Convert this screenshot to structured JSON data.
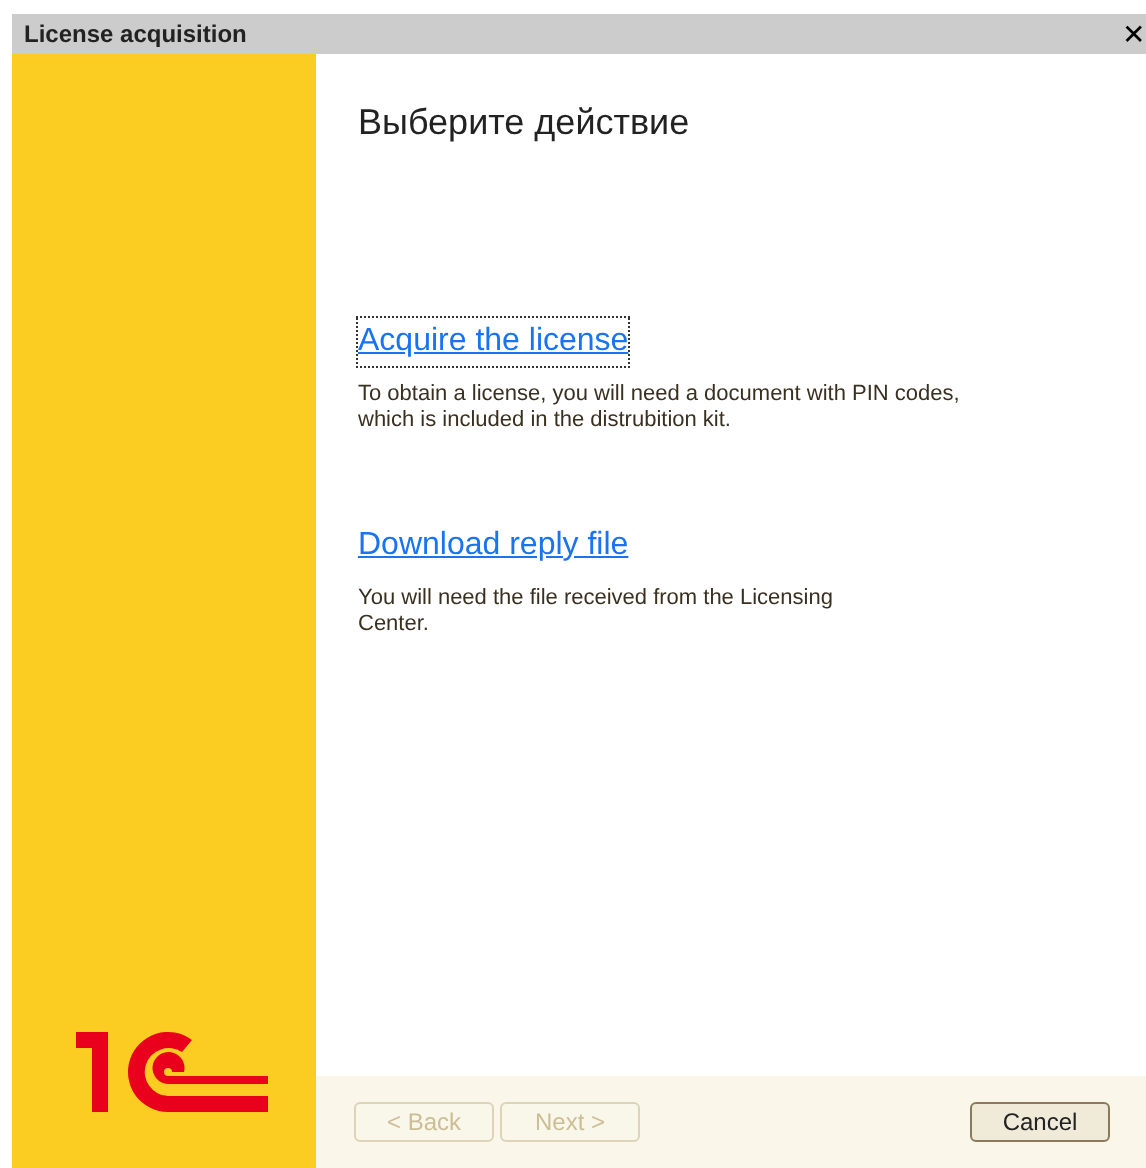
{
  "window": {
    "title": "License acquisition",
    "close": "✕"
  },
  "heading": "Выберите действие",
  "actions": [
    {
      "link": "Acquire the license",
      "focused": true,
      "description": "To obtain a license, you will need a document with PIN codes, which is included in the distrubition kit."
    },
    {
      "link": "Download reply file",
      "focused": false,
      "description": "You will need the file received from the Licensing Center."
    }
  ],
  "buttons": [
    {
      "label": "< Back",
      "disabled": true
    },
    {
      "label": "Next >",
      "disabled": true
    },
    {
      "label": "Cancel",
      "disabled": false
    }
  ]
}
